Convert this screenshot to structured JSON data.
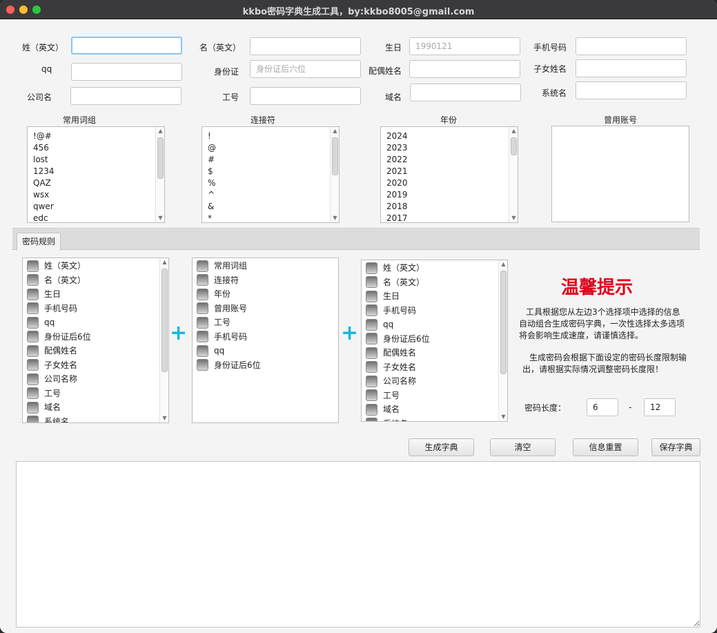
{
  "window": {
    "title": "kkbo密码字典生成工具，by:kkbo8005@gmail.com"
  },
  "fields": {
    "surname_label": "姓（英文）",
    "name_label": "名（英文）",
    "birthday_label": "生日",
    "birthday_placeholder": "1990121",
    "phone_label": "手机号码",
    "qq_label": "qq",
    "idcard_label": "身份证",
    "idcard_placeholder": "身份证后六位",
    "spouse_label": "配偶姓名",
    "child_label": "子女姓名",
    "company_label": "公司名",
    "employee_id_label": "工号",
    "domain_label": "域名",
    "system_label": "系统名"
  },
  "lists": {
    "common_words": {
      "header": "常用词组",
      "items": [
        "!@#",
        "456",
        "lost",
        "1234",
        "QAZ",
        "wsx",
        "qwer",
        "edc"
      ]
    },
    "connectors": {
      "header": "连接符",
      "items": [
        "!",
        "@",
        "#",
        "$",
        "%",
        "^",
        "&",
        "*"
      ]
    },
    "years": {
      "header": "年份",
      "items": [
        "2024",
        "2023",
        "2022",
        "2021",
        "2020",
        "2019",
        "2018",
        "2017"
      ]
    },
    "used_accounts": {
      "header": "曾用账号",
      "items": []
    }
  },
  "tab": {
    "label": "密码规则"
  },
  "rules": {
    "left": [
      "姓（英文）",
      "名（英文）",
      "生日",
      "手机号码",
      "qq",
      "身份证后6位",
      "配偶姓名",
      "子女姓名",
      "公司名称",
      "工号",
      "域名",
      "系统名"
    ],
    "middle": [
      "常用词组",
      "连接符",
      "年份",
      "曾用账号",
      "工号",
      "手机号码",
      "qq",
      "身份证后6位"
    ],
    "right": [
      "姓（英文）",
      "名（英文）",
      "生日",
      "手机号码",
      "qq",
      "身份证后6位",
      "配偶姓名",
      "子女姓名",
      "公司名称",
      "工号",
      "域名",
      "系统名"
    ],
    "plus": "+"
  },
  "tip": {
    "title": "温馨提示",
    "p1": "工具根据您从左边3个选择项中选择的信息自动组合生成密码字典，一次性选择太多选项将会影响生成速度，请谨慎选择。",
    "p2": "生成密码会根据下面设定的密码长度限制输出，请根据实际情况调整密码长度限！"
  },
  "length": {
    "label": "密码长度：",
    "min": "6",
    "sep": "-",
    "max": "12"
  },
  "buttons": {
    "generate": "生成字典",
    "clear": "清空",
    "reset": "信息重置",
    "save": "保存字典"
  }
}
